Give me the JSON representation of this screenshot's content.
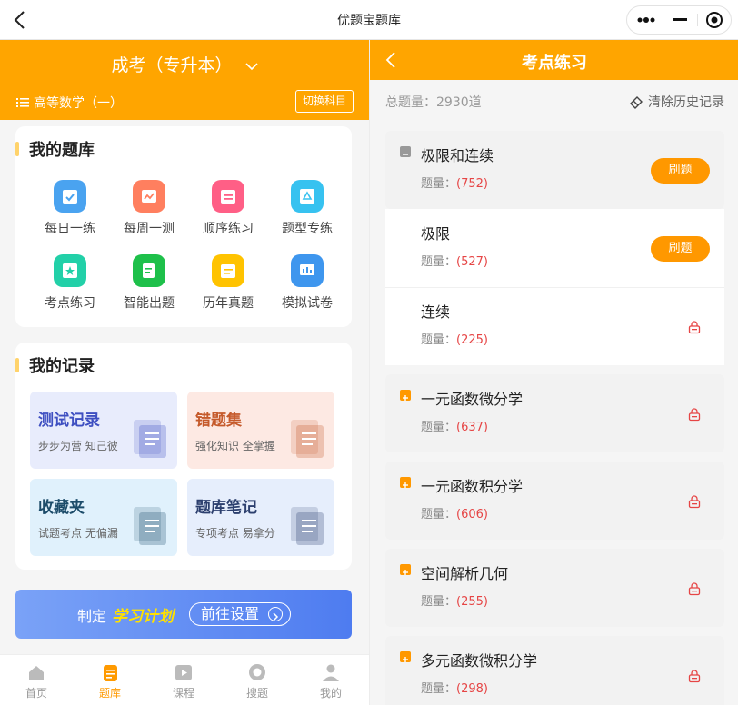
{
  "window": {
    "title": "优题宝题库"
  },
  "left": {
    "exam": "成考（专升本）",
    "subject": "高等数学（一）",
    "switch_label": "切换科目",
    "bank": {
      "title": "我的题库",
      "items": [
        {
          "label": "每日一练",
          "icon": "calendar-check-icon",
          "color": "#4aa3f0"
        },
        {
          "label": "每周一测",
          "icon": "chart-line-icon",
          "color": "#ff7f5f"
        },
        {
          "label": "顺序练习",
          "icon": "calendar-list-icon",
          "color": "#ff5f86"
        },
        {
          "label": "题型专练",
          "icon": "triangle-icon",
          "color": "#37c2f0"
        },
        {
          "label": "考点练习",
          "icon": "star-icon",
          "color": "#22d0a8"
        },
        {
          "label": "智能出题",
          "icon": "edit-doc-icon",
          "color": "#1ec04a"
        },
        {
          "label": "历年真题",
          "icon": "calendar-doc-icon",
          "color": "#ffc300"
        },
        {
          "label": "模拟试卷",
          "icon": "board-icon",
          "color": "#3e96ee"
        }
      ]
    },
    "records": {
      "title": "我的记录",
      "items": [
        {
          "title": "测试记录",
          "sub": "步步为营 知己彼",
          "bg": "#e8ecfc",
          "color": "#3e4fc1"
        },
        {
          "title": "错题集",
          "sub": "强化知识 全掌握",
          "bg": "#fde9e3",
          "color": "#c55a2b"
        },
        {
          "title": "收藏夹",
          "sub": "试题考点 无偏漏",
          "bg": "#e0f1fc",
          "color": "#1c4c6a"
        },
        {
          "title": "题库笔记",
          "sub": "专项考点 易拿分",
          "bg": "#e6eefc",
          "color": "#2c3f6e"
        }
      ]
    },
    "plan": {
      "prefix": "制定",
      "highlight": "学习计划",
      "button": "前往设置"
    },
    "tabs": [
      {
        "label": "首页",
        "icon": "home-icon"
      },
      {
        "label": "题库",
        "icon": "doc-icon",
        "active": true
      },
      {
        "label": "课程",
        "icon": "play-icon"
      },
      {
        "label": "搜题",
        "icon": "search-icon"
      },
      {
        "label": "我的",
        "icon": "user-icon"
      }
    ]
  },
  "right": {
    "title": "考点练习",
    "total": "总题量：2930道",
    "clear": "清除历史记录",
    "count_label": "题量：",
    "practice_label": "刷题",
    "points": [
      {
        "name": "极限和连续",
        "count": "(752)",
        "expanded": true,
        "unlocked": true
      },
      {
        "name": "极限",
        "count": "(527)",
        "sub": true,
        "unlocked": true
      },
      {
        "name": "连续",
        "count": "(225)",
        "sub": true,
        "unlocked": false
      },
      {
        "name": "一元函数微分学",
        "count": "(637)",
        "expanded": false,
        "unlocked": false
      },
      {
        "name": "一元函数积分学",
        "count": "(606)",
        "expanded": false,
        "unlocked": false
      },
      {
        "name": "空间解析几何",
        "count": "(255)",
        "expanded": false,
        "unlocked": false
      },
      {
        "name": "多元函数微积分学",
        "count": "(298)",
        "expanded": false,
        "unlocked": false
      }
    ]
  }
}
